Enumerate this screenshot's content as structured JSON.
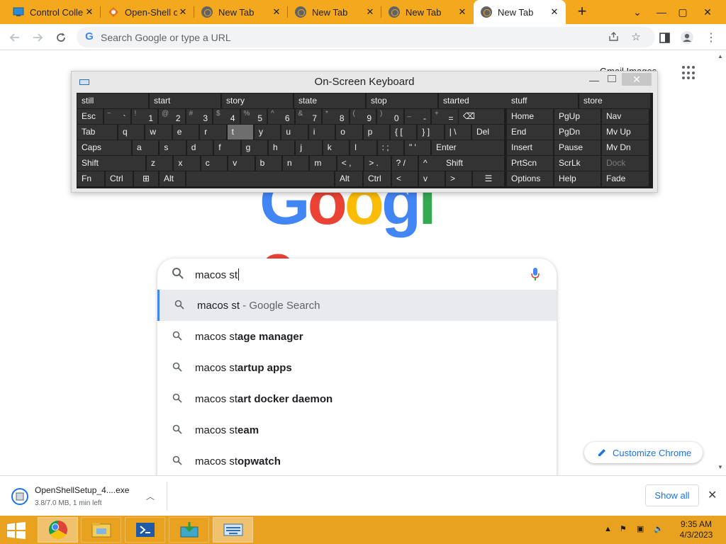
{
  "colors": {
    "tabstrip": "#f4a81d",
    "taskbar": "#e8a220",
    "accent_blue": "#1a73e8",
    "osk_key": "#333333",
    "osk_bg": "#1d1d1d"
  },
  "tabs": [
    {
      "title": "Control Colle",
      "icon": "control-panel-icon"
    },
    {
      "title": "Open-Shell o",
      "icon": "openshell-icon"
    },
    {
      "title": "New Tab",
      "icon": "chrome-icon"
    },
    {
      "title": "New Tab",
      "icon": "chrome-icon"
    },
    {
      "title": "New Tab",
      "icon": "chrome-icon"
    },
    {
      "title": "New Tab",
      "icon": "chrome-icon",
      "active": true
    }
  ],
  "window": {
    "minimize": "—",
    "maximize": "▢",
    "close": "✕",
    "tab_menu": "⌄",
    "new_tab": "+"
  },
  "toolbar": {
    "omnibox_placeholder": "Search Google or type a URL"
  },
  "page": {
    "gmail_link": "Gmail  Images",
    "logo_letters": [
      "G",
      "o",
      "o",
      "g",
      "l",
      "e"
    ],
    "search": {
      "value": "macos st",
      "suggestions": [
        {
          "typed": "macos st",
          "completion": "",
          "suffix": " - Google Search",
          "selected": true
        },
        {
          "typed": "macos st",
          "completion": "age manager",
          "suffix": ""
        },
        {
          "typed": "macos st",
          "completion": "artup apps",
          "suffix": ""
        },
        {
          "typed": "macos st",
          "completion": "art docker daemon",
          "suffix": ""
        },
        {
          "typed": "macos st",
          "completion": "eam",
          "suffix": ""
        },
        {
          "typed": "macos st",
          "completion": "opwatch",
          "suffix": ""
        }
      ]
    },
    "customize_label": "Customize Chrome"
  },
  "osk": {
    "title": "On-Screen Keyboard",
    "predictions": [
      "still",
      "start",
      "story",
      "state",
      "stop",
      "started"
    ],
    "right_predictions": [
      "stuff",
      "store"
    ],
    "row1": [
      {
        "up": "",
        "lo": "Esc"
      },
      {
        "up": "~",
        "lo": "`"
      },
      {
        "up": "!",
        "lo": "1"
      },
      {
        "up": "@",
        "lo": "2"
      },
      {
        "up": "#",
        "lo": "3"
      },
      {
        "up": "$",
        "lo": "4"
      },
      {
        "up": "%",
        "lo": "5"
      },
      {
        "up": "^",
        "lo": "6"
      },
      {
        "up": "&",
        "lo": "7"
      },
      {
        "up": "*",
        "lo": "8"
      },
      {
        "up": "(",
        "lo": "9"
      },
      {
        "up": ")",
        "lo": "0"
      },
      {
        "up": "_",
        "lo": "-"
      },
      {
        "up": "+",
        "lo": "="
      },
      {
        "up": "",
        "lo": "⌫"
      }
    ],
    "row2": [
      "Tab",
      "q",
      "w",
      "e",
      "r",
      "t",
      "y",
      "u",
      "i",
      "o",
      "p",
      "{ [",
      "} ]",
      "| \\",
      "Del"
    ],
    "row3": [
      "Caps",
      "a",
      "s",
      "d",
      "f",
      "g",
      "h",
      "j",
      "k",
      "l",
      ": ;",
      "\" '",
      "Enter"
    ],
    "row4": [
      "Shift",
      "z",
      "x",
      "c",
      "v",
      "b",
      "n",
      "m",
      "< ,",
      "> .",
      "? /",
      "^",
      "Shift"
    ],
    "row5": [
      "Fn",
      "Ctrl",
      "⊞",
      "Alt",
      "",
      "Alt",
      "Ctrl",
      "<",
      "v",
      ">",
      "☰"
    ],
    "nav": [
      [
        "Home",
        "PgUp",
        "Nav"
      ],
      [
        "End",
        "PgDn",
        "Mv Up"
      ],
      [
        "Insert",
        "Pause",
        "Mv Dn"
      ],
      [
        "PrtScn",
        "ScrLk",
        "Dock"
      ],
      [
        "Options",
        "Help",
        "Fade"
      ]
    ]
  },
  "downloads": {
    "filename": "OpenShellSetup_4....exe",
    "meta": "3.8/7.0 MB, 1 min left",
    "show_all": "Show all"
  },
  "taskbar": {
    "time": "9:35 AM",
    "date": "4/3/2023",
    "apps": [
      "chrome-icon",
      "file-explorer-icon",
      "powershell-icon",
      "install-icon",
      "on-screen-keyboard-icon"
    ]
  }
}
